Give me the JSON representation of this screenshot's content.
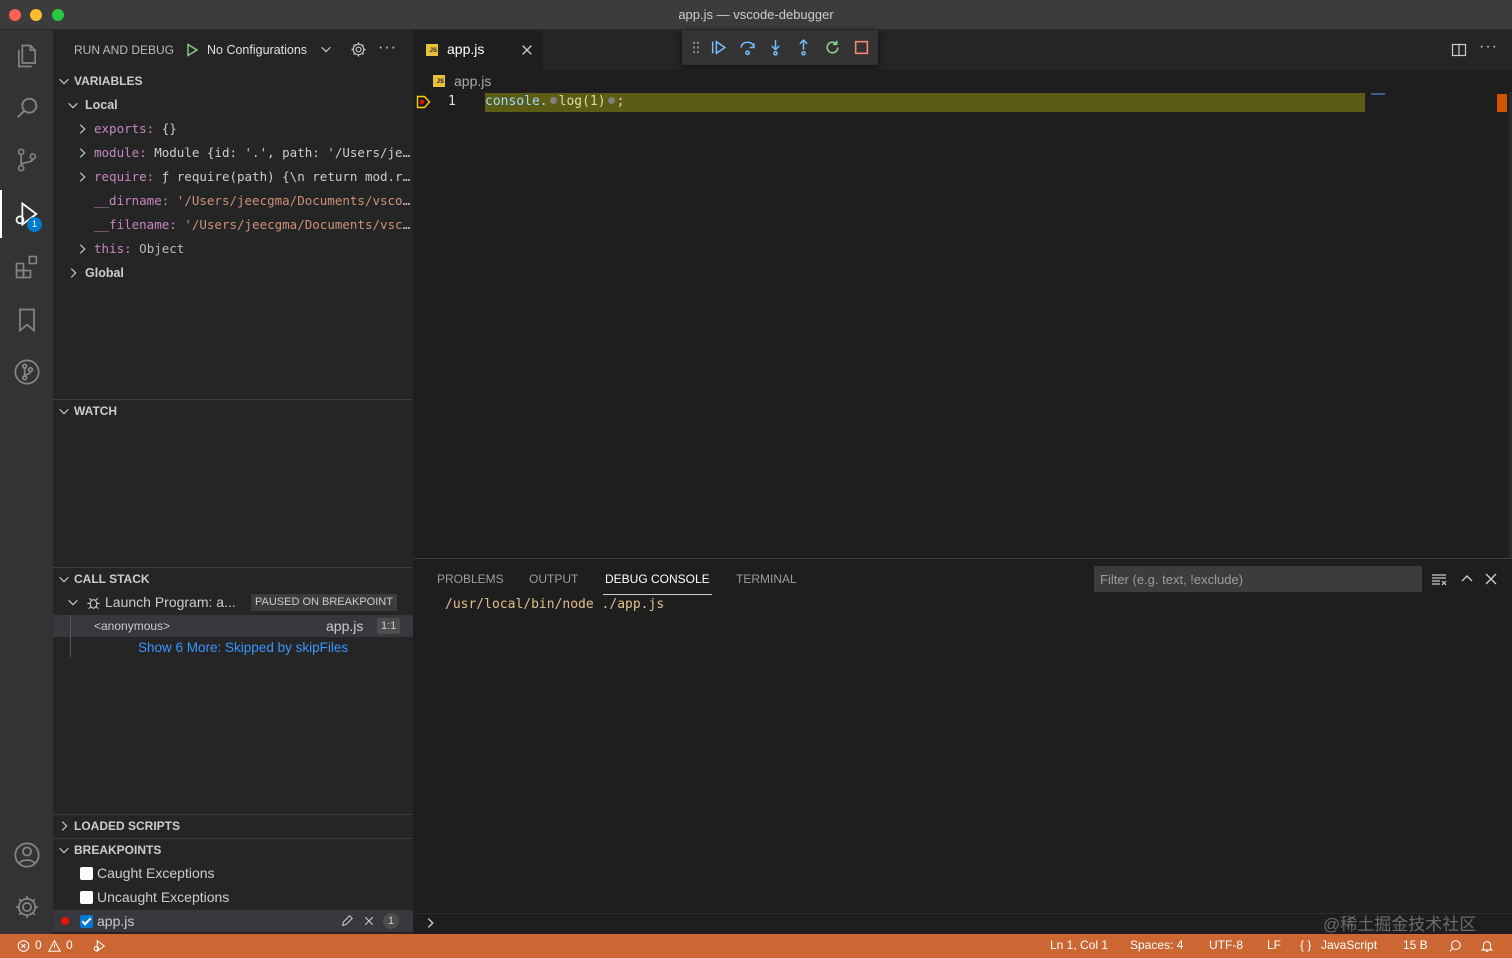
{
  "window": {
    "title": "app.js — vscode-debugger"
  },
  "activity_bar": {
    "items": [
      {
        "icon": "explorer-icon"
      },
      {
        "icon": "search-icon"
      },
      {
        "icon": "source-control-icon"
      },
      {
        "icon": "run-debug-icon",
        "badge": "1",
        "active": true
      },
      {
        "icon": "extensions-icon"
      },
      {
        "icon": "bookmarks-icon"
      },
      {
        "icon": "git-graph-icon"
      }
    ],
    "bottom": [
      {
        "icon": "account-icon"
      },
      {
        "icon": "manage-gear-icon"
      }
    ]
  },
  "sidebar": {
    "title": "RUN AND DEBUG",
    "config": "No Configurations",
    "more": "···",
    "variables": {
      "header": "VARIABLES",
      "local_label": "Local",
      "global_label": "Global",
      "items": [
        {
          "name": "exports:",
          "value": "{}"
        },
        {
          "name": "module:",
          "value": "Module {id: '.', path: '/Users/jeecgma/Documents/vscode-debugger'}"
        },
        {
          "name": "require:",
          "value": "ƒ require(path) {\\n      return mod.require(path);"
        },
        {
          "name": "__dirname:",
          "value": "'/Users/jeecgma/Documents/vscode-debugger'"
        },
        {
          "name": "__filename:",
          "value": "'/Users/jeecgma/Documents/vscode-debugger/app.js'"
        },
        {
          "name": "this:",
          "value": "Object"
        }
      ]
    },
    "watch": {
      "header": "WATCH"
    },
    "call_stack": {
      "header": "CALL STACK",
      "session": "Launch Program: a...",
      "status": "PAUSED ON BREAKPOINT",
      "frame_name": "<anonymous>",
      "frame_file": "app.js",
      "frame_pos": "1:1",
      "show_more": "Show 6 More: Skipped by skipFiles"
    },
    "loaded_scripts": {
      "header": "LOADED SCRIPTS"
    },
    "breakpoints": {
      "header": "BREAKPOINTS",
      "items": [
        {
          "label": "Caught Exceptions",
          "checked": false
        },
        {
          "label": "Uncaught Exceptions",
          "checked": false
        },
        {
          "label": "app.js",
          "checked": true,
          "count": "1"
        }
      ]
    }
  },
  "editor": {
    "tab_label": "app.js",
    "tab_icon": "JS",
    "breadcrumb": "app.js",
    "line_number": "1",
    "code_a": "console.",
    "code_b": "log(1)",
    "code_c": ";",
    "more": "···"
  },
  "panel": {
    "tabs": [
      "PROBLEMS",
      "OUTPUT",
      "DEBUG CONSOLE",
      "TERMINAL"
    ],
    "active_tab": "DEBUG CONSOLE",
    "filter_placeholder": "Filter (e.g. text, !exclude)",
    "console_line_cmd": "/usr/local/bin/node",
    "console_line_arg": "./app.js",
    "watermark": "@稀土掘金技术社区"
  },
  "status_bar": {
    "errors": "0",
    "warnings": "0",
    "position": "Ln 1, Col 1",
    "spaces": "Spaces: 4",
    "encoding": "UTF-8",
    "eol": "LF",
    "language": "JavaScript",
    "size": "15 B",
    "language_braces": "{ }"
  },
  "colors": {
    "status_bar": "#cc6633",
    "accent": "#007acc",
    "line_highlight": "#5c5c15",
    "breakpoint": "#e51400"
  }
}
